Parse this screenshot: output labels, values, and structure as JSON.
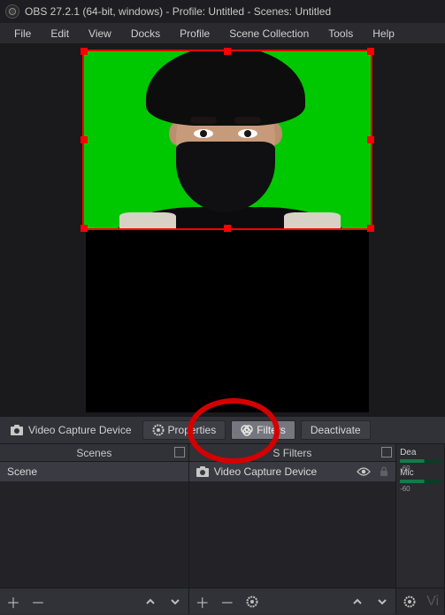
{
  "title": "OBS 27.2.1 (64-bit, windows) - Profile: Untitled - Scenes: Untitled",
  "menu": [
    "File",
    "Edit",
    "View",
    "Docks",
    "Profile",
    "Scene Collection",
    "Tools",
    "Help"
  ],
  "context": {
    "source_label": "Video Capture Device",
    "properties": "Properties",
    "filters": "Filters",
    "deactivate": "Deactivate"
  },
  "panels": {
    "scenes": {
      "title": "Scenes",
      "items": [
        "Scene"
      ]
    },
    "sources": {
      "title": "S Filters",
      "items": [
        "Video Capture Device"
      ]
    }
  },
  "mixer": {
    "tracks": [
      {
        "name": "Dea",
        "lo": "-60",
        "hi": ""
      },
      {
        "name": "Mic",
        "lo": "-60",
        "hi": ""
      }
    ]
  }
}
